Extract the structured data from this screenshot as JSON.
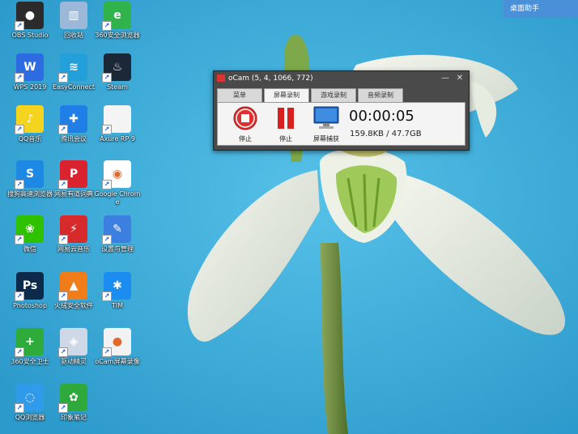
{
  "corner_widget": {
    "label": "桌面助手"
  },
  "desktop_icons": [
    {
      "label": "OBS Studio",
      "color": "#2b2b2b",
      "glyph": "●"
    },
    {
      "label": "回收站",
      "color": "#9bb8d8",
      "glyph": "▥"
    },
    {
      "label": "360安全浏览器",
      "color": "#2fb34a",
      "glyph": "e"
    },
    {
      "label": "WPS 2019",
      "color": "#2d6be0",
      "glyph": "W"
    },
    {
      "label": "EasyConnect",
      "color": "#23a0d9",
      "glyph": "≋"
    },
    {
      "label": "Steam",
      "color": "#1b2838",
      "glyph": "♨"
    },
    {
      "label": "QQ音乐",
      "color": "#f5d41f",
      "glyph": "♪"
    },
    {
      "label": "腾讯会议",
      "color": "#1f7fe6",
      "glyph": "✚"
    },
    {
      "label": "Axure RP 9",
      "color": "#f4f4f4",
      "glyph": ""
    },
    {
      "label": "搜狗高速浏览器",
      "color": "#1e88e5",
      "glyph": "S"
    },
    {
      "label": "网易有道词典",
      "color": "#d9232f",
      "glyph": "P"
    },
    {
      "label": "Google Chrome",
      "color": "#ffffff",
      "glyph": "◉"
    },
    {
      "label": "微信",
      "color": "#2dc100",
      "glyph": "❀"
    },
    {
      "label": "网易云音乐",
      "color": "#d72b2b",
      "glyph": "⚡"
    },
    {
      "label": "设置与管理",
      "color": "#3d7fe0",
      "glyph": "✎"
    },
    {
      "label": "Photoshop",
      "color": "#0d2a4a",
      "glyph": "Ps"
    },
    {
      "label": "火绒安全软件",
      "color": "#f07c1a",
      "glyph": "▲"
    },
    {
      "label": "TIM",
      "color": "#1b8df1",
      "glyph": "✱"
    },
    {
      "label": "360安全卫士",
      "color": "#2eab3a",
      "glyph": "+"
    },
    {
      "label": "驱动精灵",
      "color": "#cfd8e6",
      "glyph": "◈"
    },
    {
      "label": "oCam屏幕录像",
      "color": "#f2f2f2",
      "glyph": "●"
    },
    {
      "label": "QQ浏览器",
      "color": "#2f9bea",
      "glyph": "◌"
    },
    {
      "label": "印象笔记",
      "color": "#2fa93b",
      "glyph": "✿"
    }
  ],
  "ocam": {
    "title": "oCam (5, 4, 1066, 772)",
    "minimize": "—",
    "close": "✕",
    "tabs": [
      "菜单",
      "屏幕录制",
      "游戏录制",
      "音频录制"
    ],
    "active_tab": 1,
    "tools": [
      {
        "label": "停止",
        "icon": "record-stop-icon"
      },
      {
        "label": "停止",
        "icon": "pause-icon"
      },
      {
        "label": "屏幕捕获",
        "icon": "monitor-icon"
      }
    ],
    "timer": "00:00:05",
    "size": "159.8KB / 47.7GB",
    "colors": {
      "record_red": "#e03030",
      "pause_red": "#d92020"
    }
  }
}
